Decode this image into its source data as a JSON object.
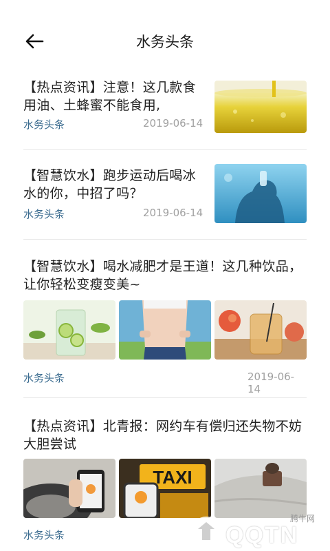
{
  "header": {
    "title": "水务头条"
  },
  "articles": [
    {
      "title": "【热点资讯】注意！这几款食用油、土蜂蜜不能食用,",
      "source": "水务头条",
      "date": "2019-06-14"
    },
    {
      "title": "【智慧饮水】跑步运动后喝冰水的你，中招了吗？",
      "source": "水务头条",
      "date": "2019-06-14"
    },
    {
      "title": "【智慧饮水】喝水减肥才是王道！这几种饮品，让你轻松变瘦变美~",
      "source": "水务头条",
      "date": "2019-06-14"
    },
    {
      "title": "【热点资讯】北青报：网约车有偿归还失物不妨大胆尝试",
      "source": "水务头条",
      "date": ""
    }
  ],
  "thumbs": {
    "taxi_sign": "TAXI"
  },
  "watermark": {
    "brand": "QQTN",
    "subtitle": "腾牛网"
  },
  "colors": {
    "source": "#3a6b8f",
    "date": "#a0a0a0",
    "divider": "#e8e8e8"
  }
}
